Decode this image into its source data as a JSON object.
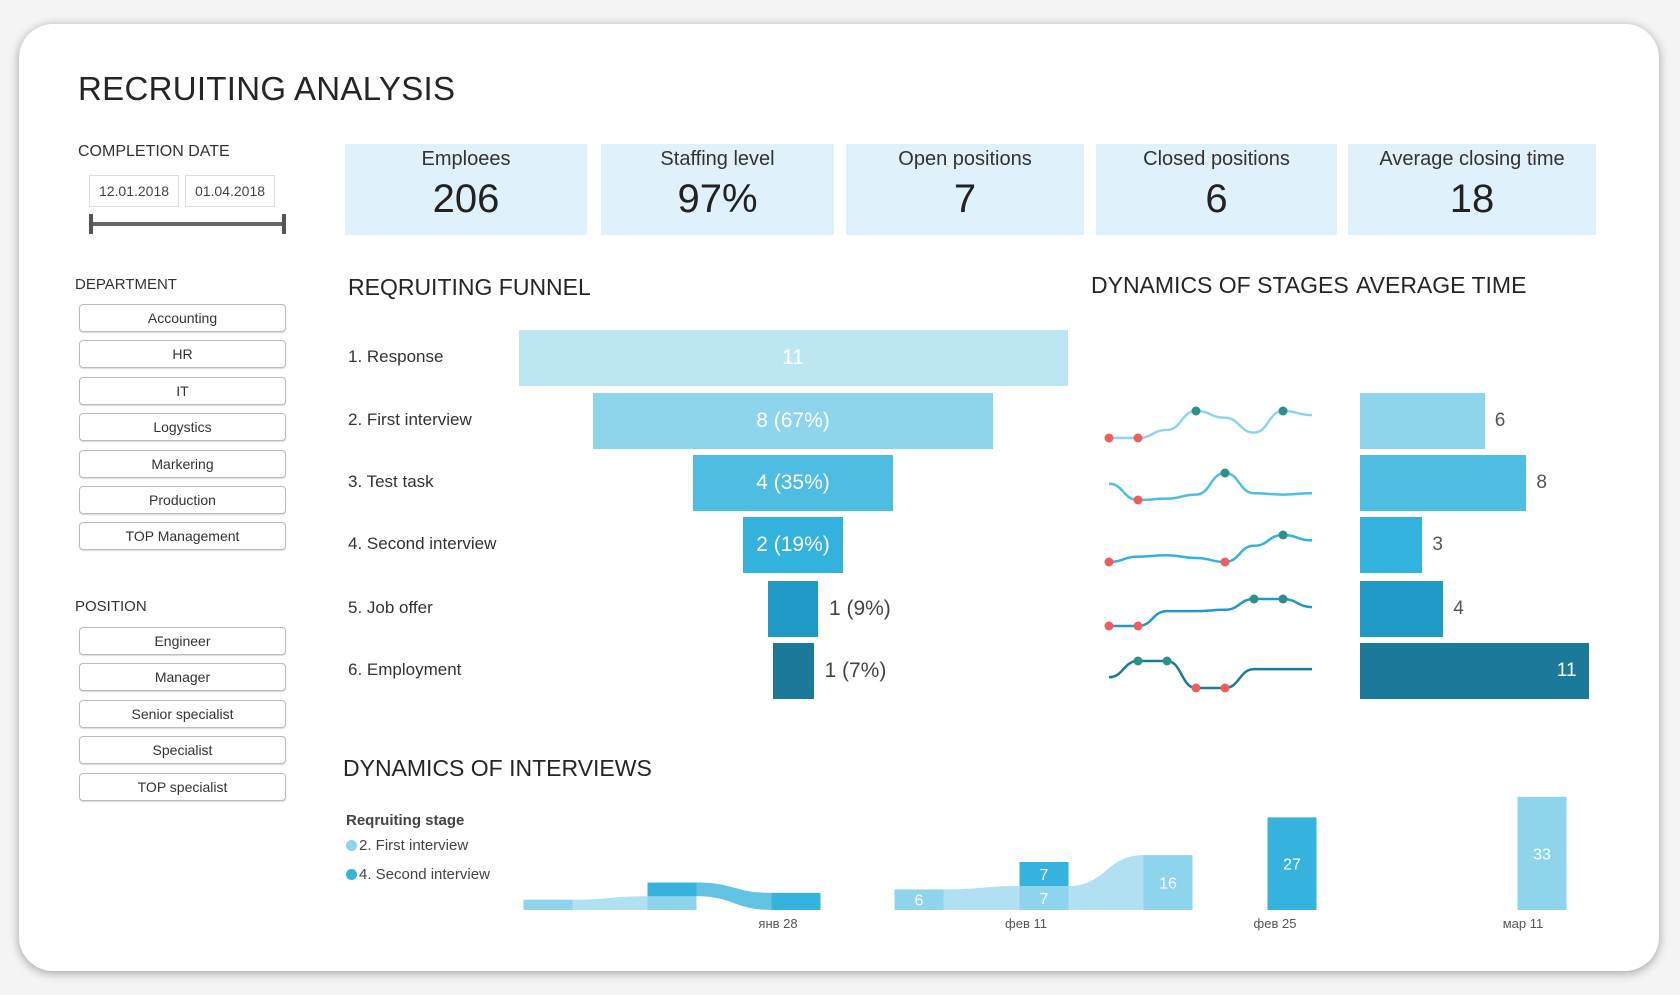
{
  "title": "RECRUITING ANALYSIS",
  "filters": {
    "completion_date": {
      "label": "COMPLETION DATE",
      "start": "12.01.2018",
      "end": "01.04.2018"
    },
    "department": {
      "label": "DEPARTMENT",
      "items": [
        "Accounting",
        "HR",
        "IT",
        "Logystics",
        "Markering",
        "Production",
        "TOP Management"
      ]
    },
    "position": {
      "label": "POSITION",
      "items": [
        "Engineer",
        "Manager",
        "Senior specialist",
        "Specialist",
        "TOP specialist"
      ]
    }
  },
  "kpis": [
    {
      "label": "Emploees",
      "value": "206"
    },
    {
      "label": "Staffing level",
      "value": "97%"
    },
    {
      "label": "Open positions",
      "value": "7"
    },
    {
      "label": "Closed positions",
      "value": "6"
    },
    {
      "label": "Average closing time",
      "value": "18"
    }
  ],
  "sections": {
    "funnel": "REQRUITING FUNNEL",
    "stages": "DYNAMICS OF STAGES",
    "avg_time": "AVERAGE TIME",
    "interviews": "DYNAMICS OF INTERVIEWS"
  },
  "colors": {
    "stages": [
      "#bde6f3",
      "#8dd4ec",
      "#4fbde1",
      "#32b2dd",
      "#2199c7",
      "#1b7a99"
    ],
    "min_dot": "#f25c5c",
    "max_dot": "#2e8f8f",
    "first_interview": "#8dd4ec",
    "second_interview": "#35b3dc"
  },
  "chart_data": [
    {
      "type": "bar",
      "title": "REQRUITING FUNNEL",
      "categories": [
        "1. Response",
        "2. First interview",
        "3. Test task",
        "4. Second interview",
        "5. Job offer",
        "6. Employment"
      ],
      "values": [
        11,
        8,
        4,
        2,
        1,
        1
      ],
      "labels": [
        "11",
        "8 (67%)",
        "4 (35%)",
        "2 (19%)",
        "1 (9%)",
        "1 (7%)"
      ]
    },
    {
      "type": "line",
      "title": "DYNAMICS OF STAGES",
      "series": [
        {
          "values": [
            0,
            0,
            0.3,
            1,
            0.75,
            0.2,
            1,
            0.85
          ]
        },
        {
          "values": [
            0.6,
            0,
            0.05,
            0.2,
            1,
            0.25,
            0.2,
            0.25
          ]
        },
        {
          "values": [
            0,
            0.2,
            0.25,
            0.15,
            0,
            0.6,
            1,
            0.8
          ]
        },
        {
          "values": [
            0,
            0,
            0.55,
            0.55,
            0.6,
            1,
            1,
            0.7
          ]
        },
        {
          "values": [
            0.4,
            1,
            1,
            0,
            0,
            0.7,
            0.7,
            0.7
          ]
        }
      ]
    },
    {
      "type": "bar",
      "title": "AVERAGE TIME",
      "categories": [
        "2. First interview",
        "3. Test task",
        "4. Second interview",
        "5. Job offer",
        "6. Employment"
      ],
      "values": [
        6,
        8,
        3,
        4,
        11
      ]
    },
    {
      "type": "bar",
      "title": "DYNAMICS OF INTERVIEWS",
      "legend_title": "Reqruiting stage",
      "ticks": [
        "янв 28",
        "фев 11",
        "фев 25",
        "мар 11"
      ],
      "series": [
        {
          "name": "2. First interview",
          "values": [
            3,
            4,
            0,
            6,
            7,
            16,
            0,
            0,
            33
          ]
        },
        {
          "name": "4. Second interview",
          "values": [
            0,
            4,
            5,
            0,
            7,
            0,
            27,
            0,
            0
          ]
        }
      ]
    }
  ]
}
